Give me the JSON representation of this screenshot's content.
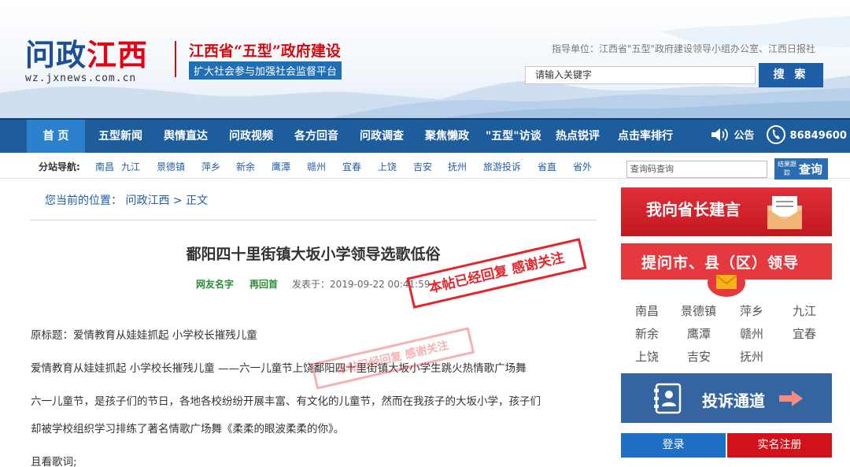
{
  "header": {
    "logo_part1": "问政",
    "logo_part2": "江西",
    "logo_url": "wz.jxnews.com.cn",
    "slogan_main": "江西省“五型”政府建设",
    "slogan_sub": "扩大社会参与加强社会监督平台",
    "guide_text": "指导单位：江西省\"五型\"政府建设领导小组办公室、江西日报社",
    "search_value": "请输入关键字",
    "search_button": "搜 索"
  },
  "nav": {
    "items": [
      "首 页",
      "五型新闻",
      "舆情直达",
      "问政视频",
      "各方回音",
      "问政调查",
      "聚焦懒政",
      "\"五型\"访谈",
      "热点锐评",
      "点击率排行"
    ],
    "active_index": 0,
    "notice": "公告",
    "hotline": "86849600"
  },
  "subnav": {
    "label": "分站导航:",
    "cities": [
      "南昌",
      "九江",
      "景德镇",
      "萍乡",
      "新余",
      "鹰潭",
      "赣州",
      "宜春",
      "上饶",
      "吉安",
      "抚州",
      "旅游投诉",
      "省直",
      "省外"
    ],
    "query_placeholder": "查询码查询",
    "query_btn_small": "结果跟踪",
    "query_btn": "查询"
  },
  "breadcrumb": "您当前的位置： 问政江西 > 正文",
  "article": {
    "title": "鄱阳四十里街镇大坂小学领导选歌低俗",
    "meta_user": "网友名字",
    "meta_status": "再回首",
    "meta_date": "发表于：2019-09-22 00:41:59",
    "paragraphs": [
      "原标题：爱情教育从娃娃抓起 小学校长摧残儿童",
      "爱情教育从娃娃抓起 小学校长摧残儿童 ——六一儿童节上饶鄱阳四十里街镇大坂小学生跳火热情歌广场舞",
      "  六一儿童节，是孩子们的节日，各地各校纷纷开展丰富、有文化的儿童节，然而在我孩子的大坂小学，孩子们",
      "却被学校组织学习排练了著名情歌广场舞《柔柔的眼波柔柔的你》。",
      "  且看歌词;"
    ],
    "stamp_text": "本帖已经回复 感谢关注"
  },
  "sidebar": {
    "banner_suggest": "我向省长建言",
    "banner_ask": "提问市、县（区）领导",
    "regions": [
      "南昌",
      "景德镇",
      "萍乡",
      "九江",
      "新余",
      "鹰潭",
      "赣州",
      "宜春",
      "上饶",
      "吉安",
      "抚州"
    ],
    "banner_complaint": "投诉通道",
    "login": "登录",
    "register": "实名注册"
  },
  "colors": {
    "nav_blue": "#1d5d9c",
    "nav_active": "#2c81cf",
    "brand_red": "#d20a11",
    "link_blue": "#1f5fa5",
    "stamp_red": "#e5252b",
    "green": "#2a8c35"
  }
}
